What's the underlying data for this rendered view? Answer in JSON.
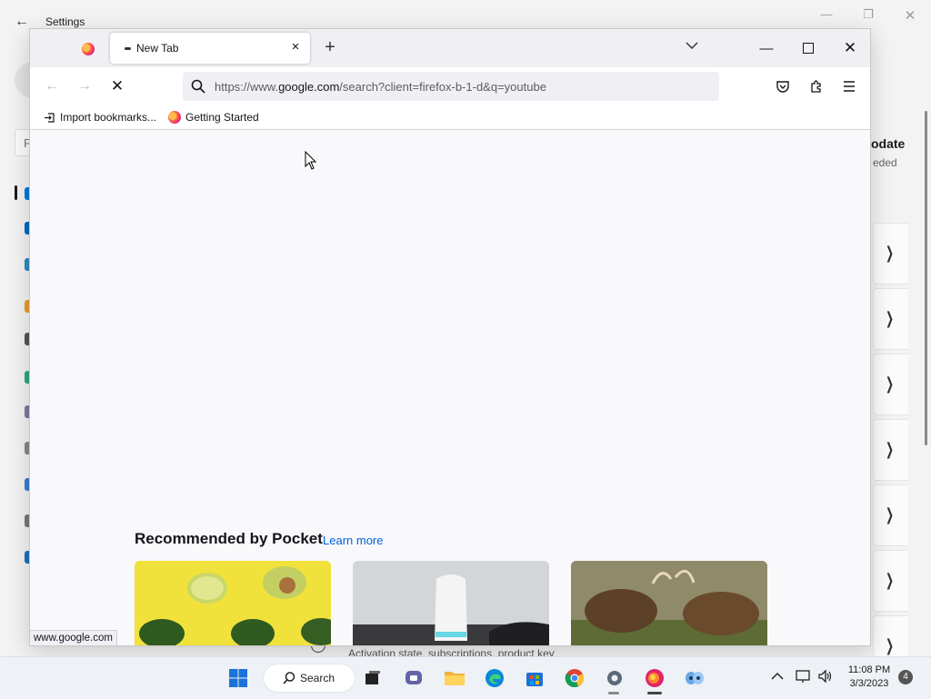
{
  "settings": {
    "title": "Settings",
    "search_placeholder": "F",
    "update_title": "odate",
    "update_subtitle": "eded",
    "behind_text": "Activation state, subscriptions, product key"
  },
  "browser": {
    "tab": {
      "title": "New Tab"
    },
    "url": {
      "prefix": "https://www.",
      "domain": "google.com",
      "suffix": "/search?client=firefox-b-1-d&q=youtube"
    },
    "bookmarks": [
      {
        "label": "Import bookmarks..."
      },
      {
        "label": "Getting Started"
      }
    ],
    "pocket": {
      "heading": "Recommended by Pocket",
      "learn_more": "Learn more"
    },
    "status_url": "www.google.com"
  },
  "taskbar": {
    "search_label": "Search",
    "time": "11:08 PM",
    "date": "3/3/2023",
    "notification_count": "4",
    "apps": [
      "start-icon",
      "search",
      "task-view-icon",
      "chat-icon",
      "file-explorer-icon",
      "edge-icon",
      "store-icon",
      "chrome-icon",
      "settings-icon",
      "firefox-icon",
      "people-icon"
    ]
  }
}
